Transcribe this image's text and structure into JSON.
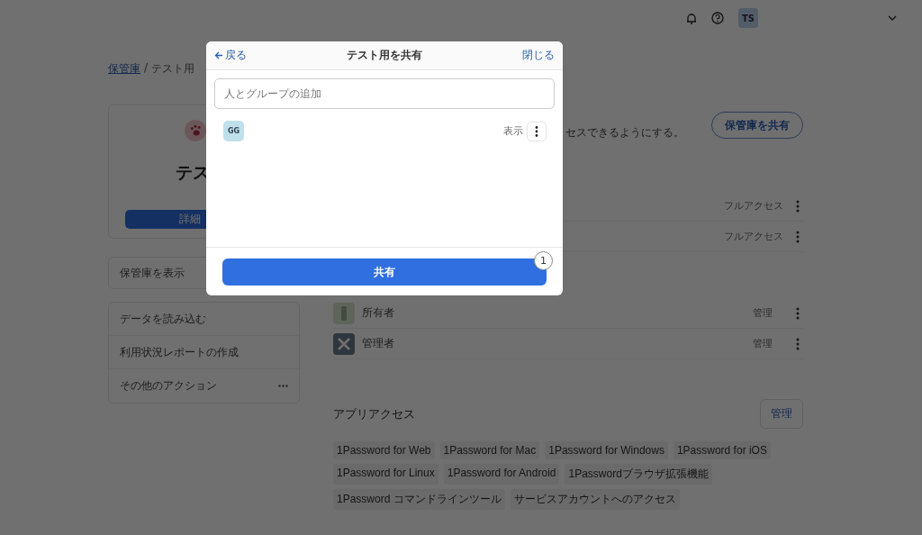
{
  "header": {
    "avatar": "TS"
  },
  "breadcrumb": {
    "parent": "保管庫",
    "separator": "/",
    "current": "テスト用"
  },
  "vault_card": {
    "title": "テス",
    "button": "詳細"
  },
  "view_item": "保管庫を表示",
  "actions": [
    "データを読み込む",
    "利用状況レポートの作成",
    "その他のアクション"
  ],
  "description": "セスできるようにする。",
  "share_button": "保管庫を共有",
  "members": [
    {
      "access": "フルアクセス"
    },
    {
      "access": "フルアクセス"
    }
  ],
  "groups": [
    {
      "name": "所有者",
      "kind": "owner",
      "access": "管理"
    },
    {
      "name": "管理者",
      "kind": "admin",
      "access": "管理"
    }
  ],
  "app_access": {
    "title": "アプリアクセス",
    "button": "管理",
    "app_rows": [
      [
        "1Password for Web",
        "1Password for Mac",
        "1Password for Windows",
        "1Password for iOS"
      ],
      [
        "1Password for Linux",
        "1Password for Android",
        "1Passwordブラウザ拡張機能"
      ],
      [
        "1Password コマンドラインツール",
        "サービスアカウントへのアクセス"
      ]
    ]
  },
  "dialog": {
    "back": "戻る",
    "title": "テスト用を共有",
    "close": "閉じる",
    "search": {
      "placeholder": "人とグループの追加"
    },
    "people": [
      {
        "initials": "GG",
        "permission": "表示"
      }
    ],
    "share_button": "共有",
    "badge": "1"
  }
}
